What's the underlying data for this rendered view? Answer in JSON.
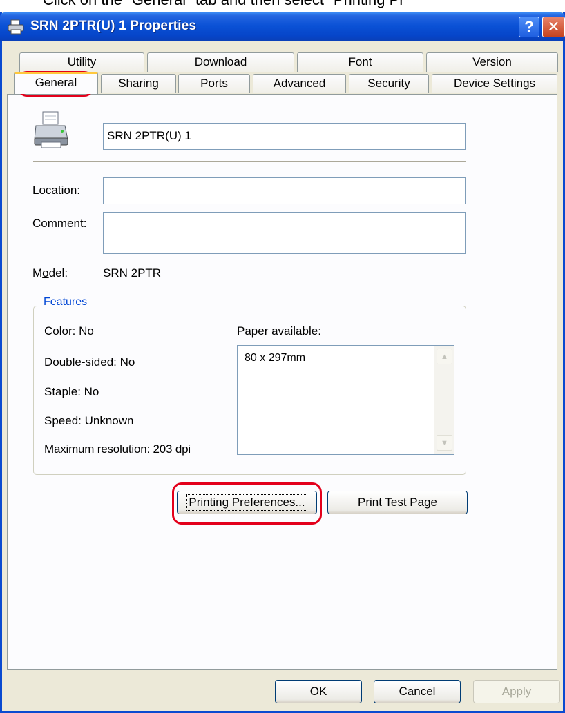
{
  "instruction": "Click on the \"General\" tab and then select \"Printing Pr",
  "window": {
    "title": "SRN 2PTR(U) 1 Properties",
    "help_label": "?",
    "close_label": "✕"
  },
  "tabs_row1": [
    "Utility",
    "Download",
    "Font",
    "Version"
  ],
  "tabs_row2": [
    "General",
    "Sharing",
    "Ports",
    "Advanced",
    "Security",
    "Device Settings"
  ],
  "general": {
    "printer_name": "SRN 2PTR(U) 1",
    "location_label_prefix": "L",
    "location_label_rest": "ocation:",
    "location_value": "",
    "comment_label_prefix": "C",
    "comment_label_rest": "omment:",
    "comment_value": "",
    "model_label_a": "M",
    "model_label_u": "o",
    "model_label_b": "del:",
    "model_value": "SRN 2PTR"
  },
  "features": {
    "legend": "Features",
    "color": "Color: No",
    "double_sided": "Double-sided: No",
    "staple": "Staple: No",
    "speed": "Speed: Unknown",
    "max_resolution": "Maximum resolution: 203 dpi",
    "paper_label": "Paper available:",
    "paper_items": [
      "80 x 297mm"
    ]
  },
  "buttons": {
    "printing_prefs_u": "P",
    "printing_prefs_rest": "rinting Preferences...",
    "print_test_a": "Print ",
    "print_test_u": "T",
    "print_test_b": "est Page",
    "ok": "OK",
    "cancel": "Cancel",
    "apply_u": "A",
    "apply_rest": "pply"
  },
  "colors": {
    "highlight": "#e3001b",
    "titlebar": "#0b52d6",
    "groupbox_legend": "#0046d5"
  }
}
